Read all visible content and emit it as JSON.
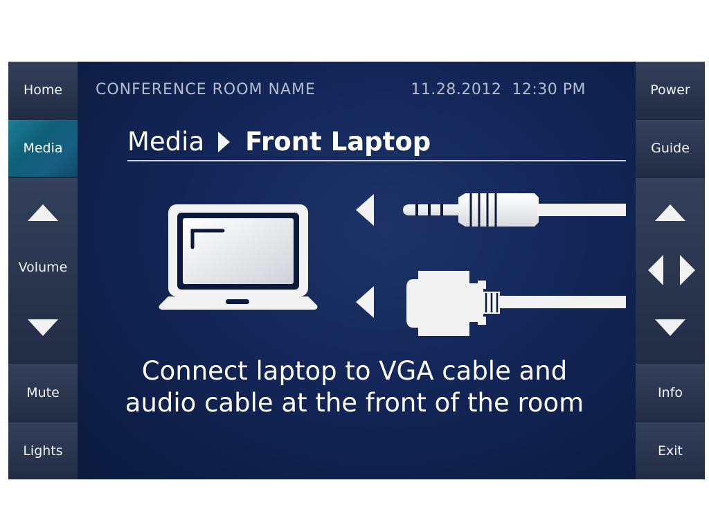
{
  "left_nav": {
    "home": "Home",
    "media": "Media",
    "volume": "Volume",
    "mute": "Mute",
    "lights": "Lights"
  },
  "right_nav": {
    "power": "Power",
    "guide": "Guide",
    "info": "Info",
    "exit": "Exit"
  },
  "header": {
    "room_name": "CONFERENCE ROOM NAME",
    "date": "11.28.2012",
    "time": "12:30 PM"
  },
  "breadcrumb": {
    "section": "Media",
    "page": "Front Laptop"
  },
  "illustration": {
    "icons": [
      "laptop-icon",
      "audio-jack-icon",
      "vga-connector-icon"
    ]
  },
  "instructions": {
    "line1": "Connect laptop to VGA cable and",
    "line2": "audio cable at the front of the room"
  },
  "colors": {
    "background": "#0b1a3c",
    "active_accent": "#1b7f94",
    "indicator": "#6cc6da",
    "button": "#2a354e"
  }
}
